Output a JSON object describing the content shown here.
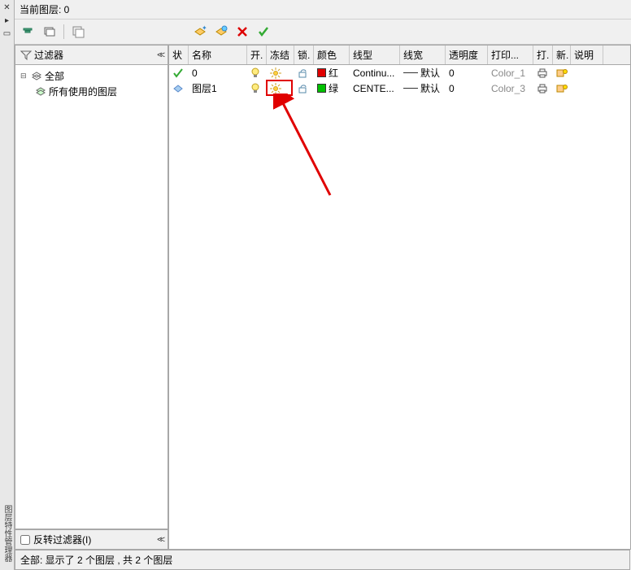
{
  "title_bar": "当前图层: 0",
  "toolbar": {
    "btn1": "layers-icon",
    "btn2": "filter-icon",
    "btn3": "match-icon",
    "btn4": "new-layer-icon",
    "btn5": "new-group-icon",
    "btn6": "delete-icon",
    "btn7": "set-current-icon"
  },
  "filter": {
    "header_label": "过滤器",
    "tree": {
      "root": "全部",
      "child": "所有使用的图层"
    },
    "invert_label": "反转过滤器(I)"
  },
  "grid": {
    "headers": {
      "status": "状",
      "name": "名称",
      "on": "开.",
      "freeze": "冻结",
      "lock": "锁.",
      "color": "颜色",
      "ltype": "线型",
      "lweight": "线宽",
      "trans": "透明度",
      "plotstyle": "打印...",
      "plot": "打.",
      "new": "新.",
      "desc": "说明"
    },
    "rows": [
      {
        "status": "current",
        "name": "0",
        "on": true,
        "freeze": false,
        "lock": false,
        "color_name": "红",
        "color_swatch": "red",
        "ltype": "Continu...",
        "lweight": "默认",
        "trans": "0",
        "plotstyle": "Color_1",
        "plot": true,
        "new": true
      },
      {
        "status": "normal",
        "name": "图层1",
        "on": true,
        "freeze": false,
        "lock": false,
        "color_name": "绿",
        "color_swatch": "green",
        "ltype": "CENTE...",
        "lweight": "默认",
        "trans": "0",
        "plotstyle": "Color_3",
        "plot": true,
        "new": true
      }
    ]
  },
  "status_bar": "全部: 显示了 2 个图层 , 共 2 个图层",
  "left_rail_bottom": "图层特性管理器"
}
